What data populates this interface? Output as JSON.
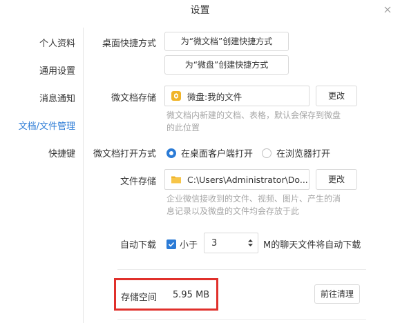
{
  "window": {
    "title": "设置",
    "close_icon": "close-icon"
  },
  "sidebar": {
    "items": [
      {
        "label": "个人资料"
      },
      {
        "label": "通用设置"
      },
      {
        "label": "消息通知"
      },
      {
        "label": "文档/文件管理",
        "active": true
      },
      {
        "label": "快捷键"
      }
    ]
  },
  "desktop_shortcut": {
    "label": "桌面快捷方式",
    "doc_button": "为“微文档”创建快捷方式",
    "disk_button": "为“微盘”创建快捷方式"
  },
  "doc_storage": {
    "label": "微文档存储",
    "value": "微盘:我的文件",
    "change_button": "更改",
    "hint_line1": "微文档内新建的文档、表格，默认会保存到微盘",
    "hint_line2": "的此位置"
  },
  "doc_open_mode": {
    "label": "微文档打开方式",
    "option_desktop": "在桌面客户端打开",
    "option_browser": "在浏览器打开",
    "selected": "desktop"
  },
  "file_storage": {
    "label": "文件存储",
    "value": "C:\\Users\\Administrator\\Do...",
    "change_button": "更改",
    "hint_line1": "企业微信接收到的文件、视频、图片、产生的消",
    "hint_line2": "息记录以及微盘的文件均会存放于此"
  },
  "auto_download": {
    "label": "自动下载",
    "checkbox_label": "小于",
    "checked": true,
    "size_value": "3",
    "suffix": "M的聊天文件将自动下载"
  },
  "storage": {
    "label": "存储空间",
    "value": "5.95 MB",
    "clean_button": "前往清理"
  },
  "colors": {
    "accent": "#2b7bd6",
    "highlight": "#e0302b",
    "folder": "#f0b429"
  }
}
